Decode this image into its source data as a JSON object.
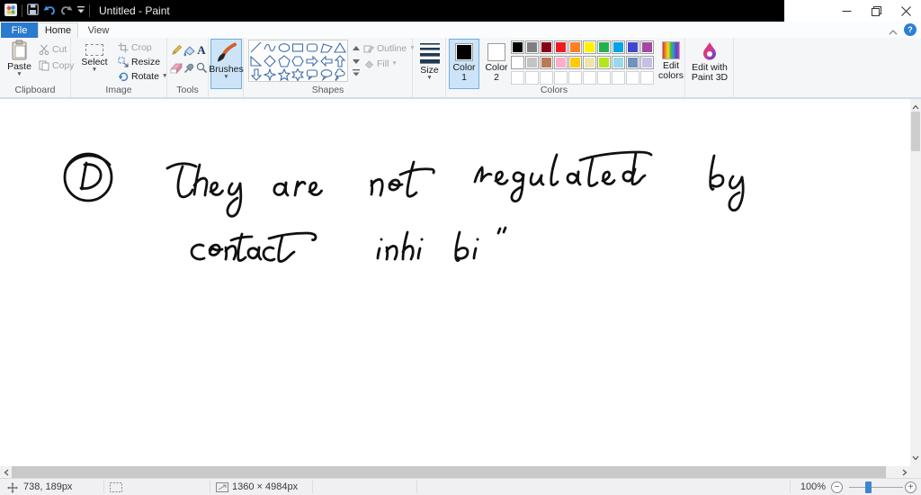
{
  "window": {
    "title": "Untitled - Paint",
    "help": "?"
  },
  "tabs": {
    "file": "File",
    "home": "Home",
    "view": "View"
  },
  "ribbon": {
    "group_labels": {
      "clipboard": "Clipboard",
      "image": "Image",
      "tools": "Tools",
      "shapes": "Shapes",
      "colors": "Colors"
    },
    "clipboard": {
      "paste": "Paste",
      "cut": "Cut",
      "copy": "Copy"
    },
    "image": {
      "select": "Select",
      "crop": "Crop",
      "resize": "Resize",
      "rotate": "Rotate"
    },
    "tools_icons": [
      "pencil",
      "fill-with-color",
      "text",
      "eraser",
      "color-picker",
      "magnifier"
    ],
    "brushes": {
      "label": "Brushes"
    },
    "shapes": {
      "outline": "Outline",
      "fill": "Fill",
      "gallery": [
        "line",
        "curve",
        "oval",
        "rectangle",
        "rounded-rectangle",
        "polygon",
        "triangle",
        "right-triangle",
        "diamond",
        "pentagon",
        "hexagon",
        "arrow-right",
        "arrow-left",
        "arrow-up",
        "arrow-down",
        "four-point-star",
        "five-point-star",
        "six-point-star",
        "rounded-callout",
        "oval-callout",
        "cloud-callout"
      ]
    },
    "size": {
      "label": "Size"
    },
    "colors": {
      "color1_label": "Color 1",
      "color2_label": "Color 2",
      "color1_value": "#000000",
      "color2_value": "#FFFFFF",
      "edit_colors_label": "Edit colors",
      "palette": [
        [
          "#000000",
          "#7F7F7F",
          "#880015",
          "#ED1C24",
          "#FF7F27",
          "#FFF200",
          "#22B14C",
          "#00A2E8",
          "#3F48CC",
          "#A349A4"
        ],
        [
          "#FFFFFF",
          "#C3C3C3",
          "#B97A57",
          "#FFAEC9",
          "#FFC90E",
          "#EFE4B0",
          "#B5E61D",
          "#99D9EA",
          "#7092BE",
          "#C8BFE7"
        ]
      ],
      "empty_slots": 10
    },
    "paint3d_label": "Edit with Paint 3D"
  },
  "canvas": {
    "handwriting_transcript": "D  They are not regulated by contact inhibi"
  },
  "statusbar": {
    "cursor_position": "738, 189px",
    "image_size": "1360 × 4984px",
    "zoom": "100%"
  }
}
